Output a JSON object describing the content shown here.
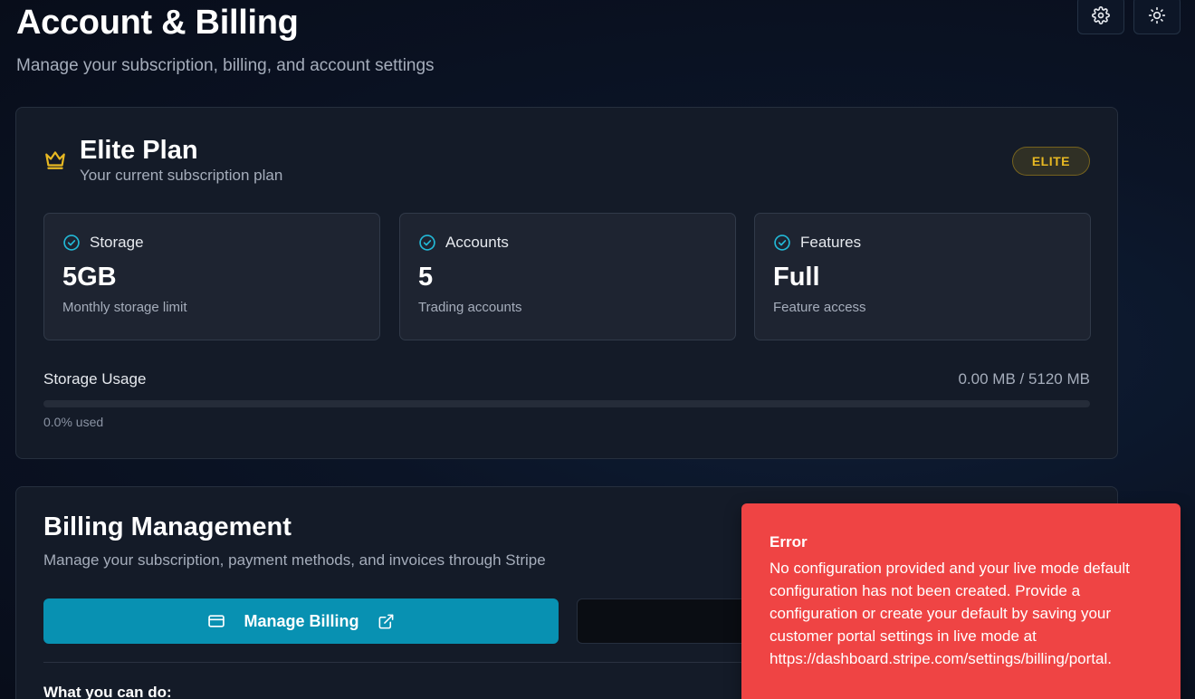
{
  "header": {
    "title": "Account & Billing",
    "subtitle": "Manage your subscription, billing, and account settings"
  },
  "toolbar": {
    "settings_icon": "gear-icon",
    "theme_icon": "sun-icon"
  },
  "plan": {
    "icon": "crown-icon",
    "name": "Elite Plan",
    "subtitle": "Your current subscription plan",
    "badge": "ELITE",
    "accent_color": "#e7b822",
    "stats": [
      {
        "label": "Storage",
        "value": "5GB",
        "desc": "Monthly storage limit",
        "icon": "check-circle-icon"
      },
      {
        "label": "Accounts",
        "value": "5",
        "desc": "Trading accounts",
        "icon": "check-circle-icon"
      },
      {
        "label": "Features",
        "value": "Full",
        "desc": "Feature access",
        "icon": "check-circle-icon"
      }
    ],
    "usage": {
      "label": "Storage Usage",
      "value": "0.00 MB / 5120 MB",
      "percent_text": "0.0% used",
      "percent": 0
    }
  },
  "billing": {
    "title": "Billing Management",
    "subtitle": "Manage your subscription, payment methods, and invoices through Stripe",
    "manage_button": "Manage Billing",
    "manage_icon": "credit-card-icon",
    "external_icon": "external-link-icon",
    "what_you_can_do": "What you can do:",
    "primary_color": "#0891b2"
  },
  "toast": {
    "title": "Error",
    "message": "No configuration provided and your live mode default configuration has not been created. Provide a configuration or create your default by saving your customer portal settings in live mode at https://dashboard.stripe.com/settings/billing/portal.",
    "color": "#ef4444"
  }
}
